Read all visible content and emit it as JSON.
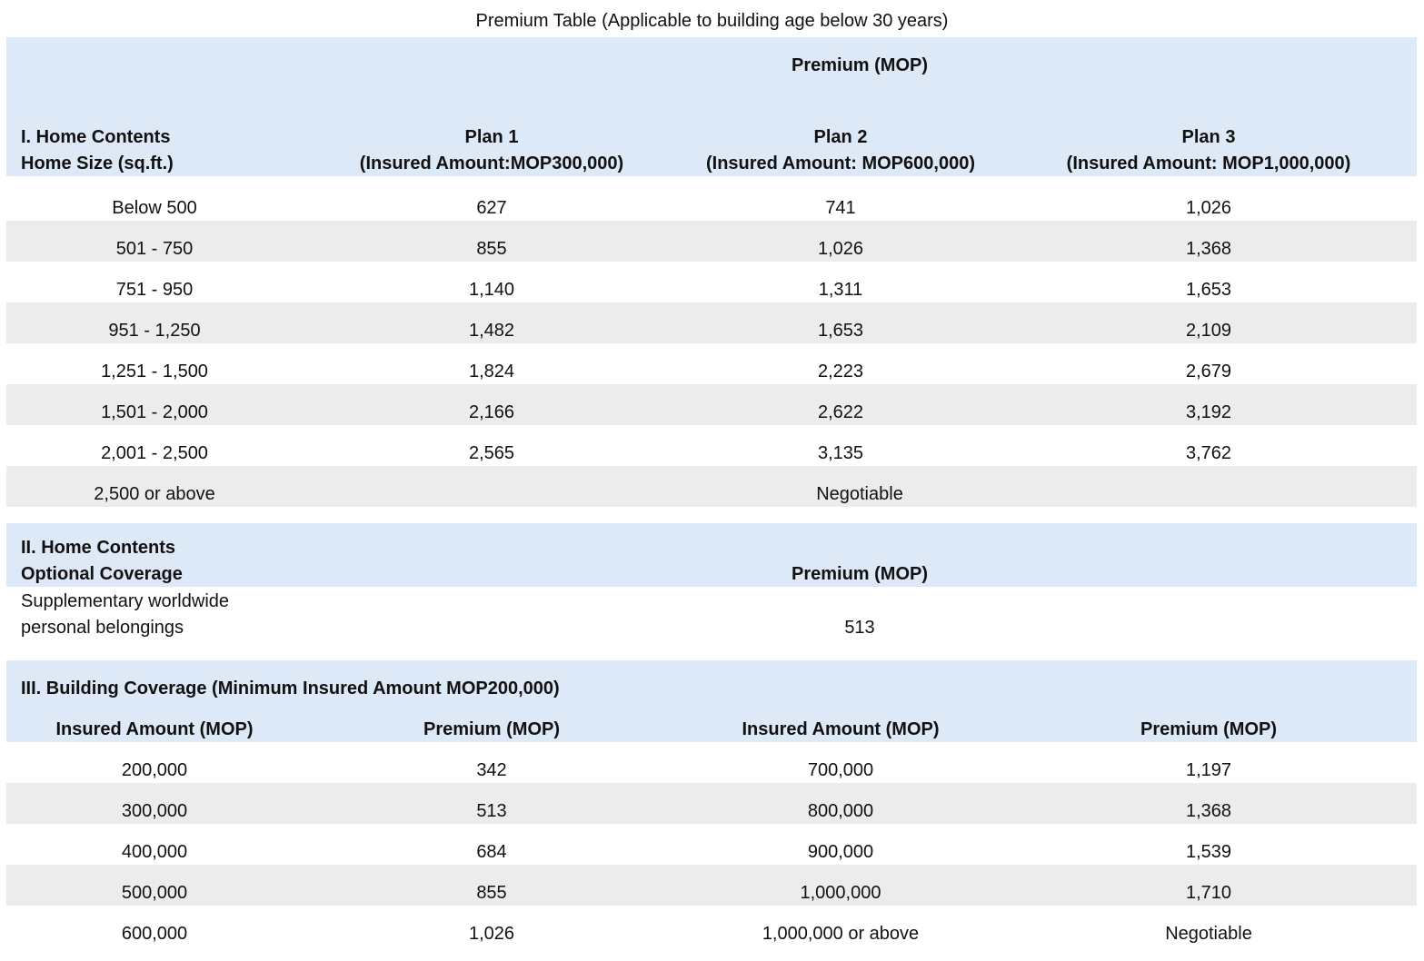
{
  "title": "Premium Table (Applicable to building age below 30 years)",
  "section1": {
    "premium_header": "Premium (MOP)",
    "header_line1": "I. Home Contents",
    "header_line2": "Home Size (sq.ft.)",
    "plans": [
      {
        "name": "Plan 1",
        "insured": "(Insured Amount:MOP300,000)"
      },
      {
        "name": "Plan 2",
        "insured": "(Insured Amount: MOP600,000)"
      },
      {
        "name": "Plan 3",
        "insured": "(Insured Amount: MOP1,000,000)"
      }
    ],
    "rows": [
      {
        "size": "Below 500",
        "p1": "627",
        "p2": "741",
        "p3": "1,026"
      },
      {
        "size": "501 - 750",
        "p1": "855",
        "p2": "1,026",
        "p3": "1,368"
      },
      {
        "size": "751 - 950",
        "p1": "1,140",
        "p2": "1,311",
        "p3": "1,653"
      },
      {
        "size": "951 - 1,250",
        "p1": "1,482",
        "p2": "1,653",
        "p3": "2,109"
      },
      {
        "size": "1,251 - 1,500",
        "p1": "1,824",
        "p2": "2,223",
        "p3": "2,679"
      },
      {
        "size": "1,501 - 2,000",
        "p1": "2,166",
        "p2": "2,622",
        "p3": "3,192"
      },
      {
        "size": "2,001 - 2,500",
        "p1": "2,565",
        "p2": "3,135",
        "p3": "3,762"
      }
    ],
    "last_row": {
      "size": "2,500 or above",
      "value": "Negotiable"
    }
  },
  "section2": {
    "header_line1": "II. Home Contents",
    "header_line2": "Optional Coverage",
    "premium_header": "Premium (MOP)",
    "item_line1": "Supplementary worldwide",
    "item_line2": "personal belongings",
    "item_value": "513"
  },
  "section3": {
    "header": "III. Building Coverage (Minimum Insured Amount MOP200,000)",
    "columns": [
      "Insured Amount (MOP)",
      "Premium (MOP)",
      "Insured Amount (MOP)",
      "Premium (MOP)"
    ],
    "rows": [
      [
        "200,000",
        "342",
        "700,000",
        "1,197"
      ],
      [
        "300,000",
        "513",
        "800,000",
        "1,368"
      ],
      [
        "400,000",
        "684",
        "900,000",
        "1,539"
      ],
      [
        "500,000",
        "855",
        "1,000,000",
        "1,710"
      ],
      [
        "600,000",
        "1,026",
        "1,000,000 or above",
        "Negotiable"
      ]
    ]
  }
}
